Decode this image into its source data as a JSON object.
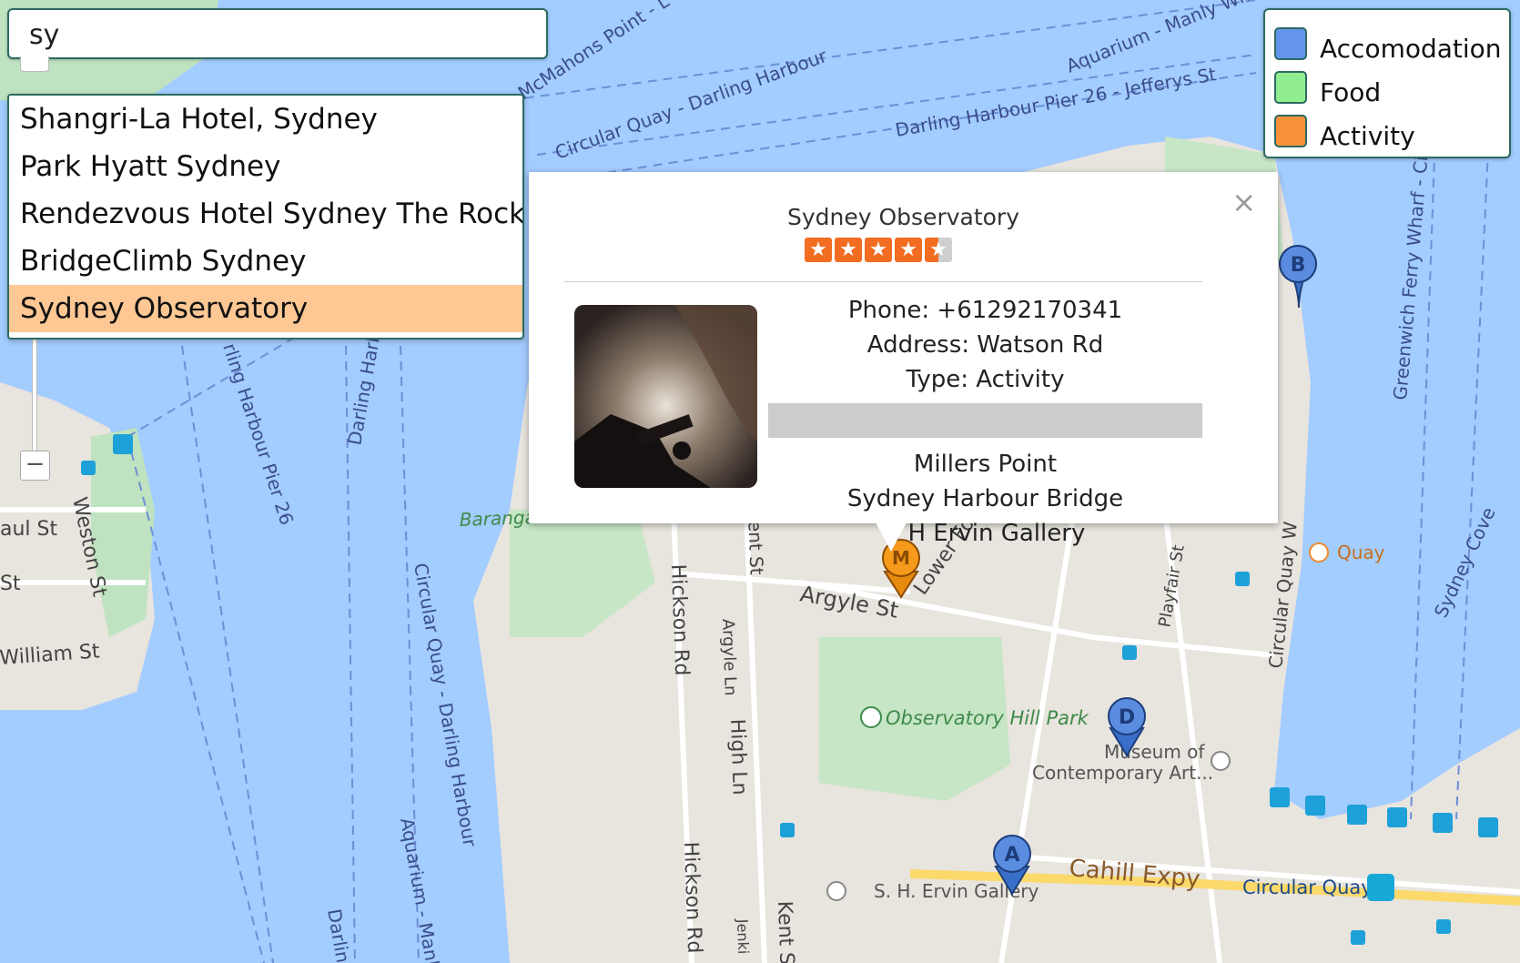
{
  "search": {
    "value": "sy"
  },
  "zoom": {
    "minus_label": "−"
  },
  "suggestions": [
    {
      "label": "Shangri-La Hotel, Sydney"
    },
    {
      "label": "Park Hyatt Sydney"
    },
    {
      "label": "Rendezvous Hotel Sydney The Rocks"
    },
    {
      "label": "BridgeClimb Sydney"
    },
    {
      "label": "Sydney Observatory"
    }
  ],
  "legend": [
    {
      "label": "Accomodation",
      "color": "#6495ed"
    },
    {
      "label": "Food",
      "color": "#90ee90"
    },
    {
      "label": "Activity",
      "color": "#f7923a"
    }
  ],
  "info": {
    "title": "Sydney Observatory",
    "rating": 4.5,
    "phone": "Phone: +61292170341",
    "address": "Address: Watson Rd",
    "type": "Type: Activity",
    "nearby": [
      "Millers Point",
      "Sydney Harbour Bridge",
      "S H Ervin Gallery"
    ],
    "close": "×"
  },
  "markers": [
    {
      "letter": "B",
      "color": "#4a7ad8"
    },
    {
      "letter": "D",
      "color": "#4a7ad8"
    },
    {
      "letter": "A",
      "color": "#4a7ad8"
    },
    {
      "letter": "M",
      "color": "#f59a1b"
    }
  ],
  "map_labels": {
    "mcmahons": "McMahons Point - L",
    "manly": "Aquarium - Manly Wharf",
    "cq_dh_top": "Circular Quay - Darling Harbour",
    "pier26_top": "Darling Harbour Pier 26 - Jefferys St",
    "paul_st": "aul St",
    "st": "St",
    "weston": "Weston St",
    "william": "William St",
    "dh_pier26": "rling Harbour Pier 26",
    "darling_harb": "Darling Harbo",
    "barangaroo": "Barangaroo Point Park",
    "kent_st": "Kent St",
    "hickson": "Hickson Rd",
    "hickson2": "Hickson Rd",
    "argyle_ln": "Argyle Ln",
    "argyle_st": "Argyle St",
    "lower_fort": "Lower Fo",
    "high_ln": "High Ln",
    "playfair": "Playfair St",
    "cq_w": "Circular Quay W",
    "quay": "Quay",
    "greenwich": "Greenwich Ferry Wharf - Circ",
    "sydney_cove": "Sydney Cove",
    "obs_hill": "Observatory Hill Park",
    "mca1": "Museum of",
    "mca2": "Contemporary Art...",
    "cahill": "Cahill Expy",
    "circular_quay": "Circular Quay",
    "ervin": "S. H. Ervin Gallery",
    "cq_dh_vert": "Circular Quay - Darling Harbour",
    "aq_manly_vert": "Aquarium - Manl",
    "darlin_bottom": "Darlin",
    "kent2": "Kent S",
    "jenki": "Jenki"
  }
}
